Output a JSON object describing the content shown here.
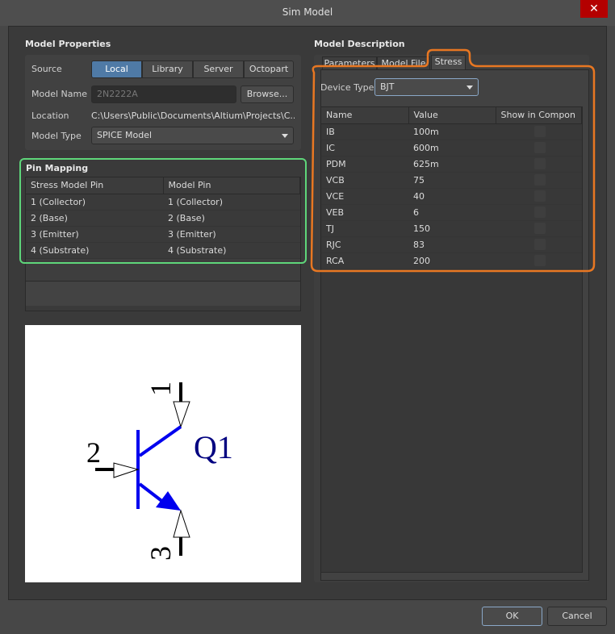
{
  "window": {
    "title": "Sim Model",
    "close_label": "✕"
  },
  "model_properties": {
    "heading": "Model Properties",
    "source_label": "Source",
    "source_options": [
      "Local",
      "Library",
      "Server",
      "Octopart"
    ],
    "source_selected": "Local",
    "model_name_label": "Model Name",
    "model_name_value": "2N2222A",
    "browse_label": "Browse...",
    "location_label": "Location",
    "location_value": "C:\\Users\\Public\\Documents\\Altium\\Projects\\C...",
    "model_type_label": "Model Type",
    "model_type_value": "SPICE Model"
  },
  "pin_mapping": {
    "heading": "Pin Mapping",
    "columns": [
      "Stress Model Pin",
      "Model Pin"
    ],
    "rows": [
      [
        "1 (Collector)",
        "1 (Collector)"
      ],
      [
        "2 (Base)",
        "2 (Base)"
      ],
      [
        "3 (Emitter)",
        "3 (Emitter)"
      ],
      [
        "4 (Substrate)",
        "4 (Substrate)"
      ]
    ],
    "highlight_color": "#5ed67a"
  },
  "symbol": {
    "designator": "Q1",
    "pins": [
      "1",
      "2",
      "3"
    ]
  },
  "model_description": {
    "heading": "Model Description",
    "tabs": [
      "Parameters",
      "Model File",
      "Stress"
    ],
    "active_tab": "Stress",
    "device_type_label": "Device Type",
    "device_type_value": "BJT",
    "columns": [
      "Name",
      "Value",
      "Show in Compon"
    ],
    "rows": [
      {
        "name": "IB",
        "value": "100m",
        "show": false
      },
      {
        "name": "IC",
        "value": "600m",
        "show": false
      },
      {
        "name": "PDM",
        "value": "625m",
        "show": false
      },
      {
        "name": "VCB",
        "value": "75",
        "show": false
      },
      {
        "name": "VCE",
        "value": "40",
        "show": false
      },
      {
        "name": "VEB",
        "value": "6",
        "show": false
      },
      {
        "name": "TJ",
        "value": "150",
        "show": false
      },
      {
        "name": "RJC",
        "value": "83",
        "show": false
      },
      {
        "name": "RCA",
        "value": "200",
        "show": false
      }
    ],
    "highlight_color": "#e87722"
  },
  "footer": {
    "ok_label": "OK",
    "cancel_label": "Cancel"
  }
}
